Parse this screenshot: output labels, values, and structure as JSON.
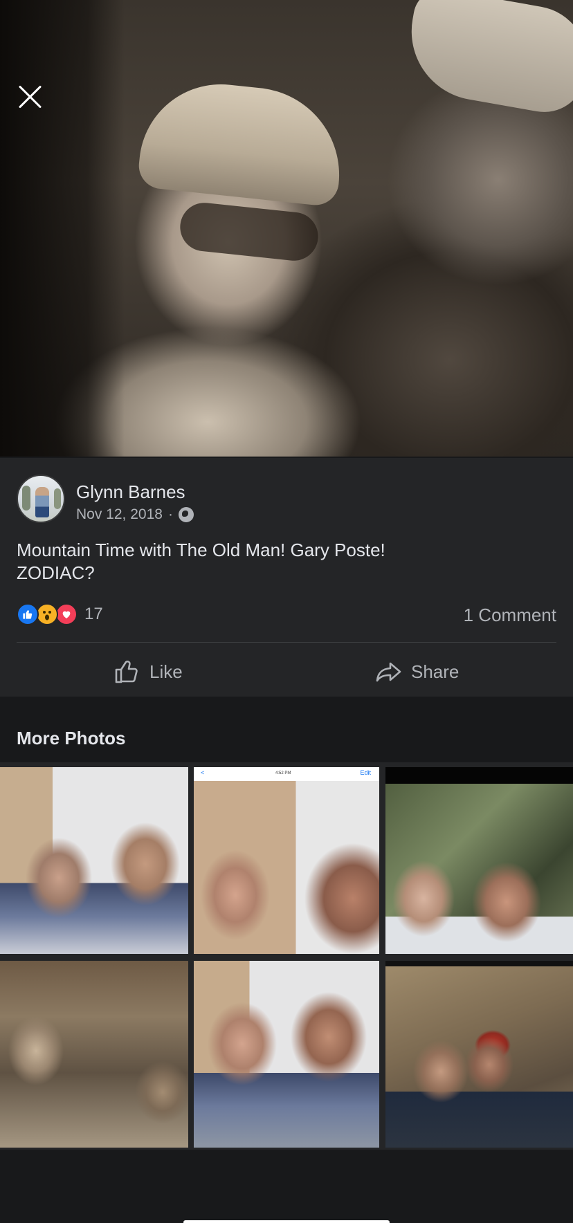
{
  "post": {
    "author": "Glynn Barnes",
    "date": "Nov 12, 2018",
    "separator": "·",
    "privacy_icon": "globe-icon",
    "caption_line1": "Mountain Time with The Old Man! Gary Poste!",
    "caption_line2": "ZODIAC?",
    "reaction_count": "17",
    "reactions": [
      "like",
      "wow",
      "love"
    ],
    "comments_label": "1 Comment",
    "like_label": "Like",
    "share_label": "Share"
  },
  "more_photos": {
    "title": "More Photos",
    "tiles": 6,
    "screenshot_tile": {
      "back": "<",
      "time": "4:52 PM",
      "edit": "Edit"
    }
  },
  "colors": {
    "background": "#18191b",
    "card": "#242527",
    "text_primary": "#e4e6eb",
    "text_secondary": "#b0b3b8",
    "like_blue": "#1877f2",
    "love_red": "#f33e58",
    "wow_yellow": "#f7b125"
  }
}
